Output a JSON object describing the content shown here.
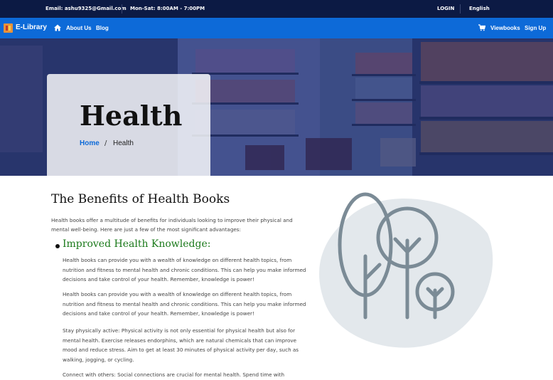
{
  "topbar": {
    "email": "Email: ashu9325@Gmail.com",
    "hours": "Mon-Sat: 8:00AM - 7:00PM",
    "login": "LOGIN",
    "language": "English"
  },
  "navbar": {
    "brand": "E-Library",
    "about": "About Us",
    "blog": "Blog",
    "viewbooks": "Viewbooks",
    "signup": "Sign Up"
  },
  "hero": {
    "title": "Health",
    "breadcrumb_home": "Home",
    "breadcrumb_sep": "/",
    "breadcrumb_current": "Health"
  },
  "content": {
    "title": "The Benefits of Health Books",
    "intro": "Health books offer a multitude of benefits for individuals looking to improve their physical and mental well-being. Here are just a few of the most significant advantages:",
    "subheading": "Improved Health Knowledge:",
    "p1": "Health books can provide you with a wealth of knowledge on different health topics, from nutrition and fitness to mental health and chronic conditions. This can help you make informed decisions and take control of your health. Remember, knowledge is power!",
    "p2": "Health books can provide you with a wealth of knowledge on different health topics, from nutrition and fitness to mental health and chronic conditions. This can help you make informed decisions and take control of your health. Remember, knowledge is power!",
    "p3": "Stay physically active: Physical activity is not only essential for physical health but also for mental health. Exercise releases endorphins, which are natural chemicals that can improve mood and reduce stress. Aim to get at least 30 minutes of physical activity per day, such as walking, jogging, or cycling.",
    "p4": "Connect with others: Social connections are crucial for mental health. Spend time with"
  },
  "colors": {
    "topbar": "#0c1a44",
    "navbar": "#0d6ad8",
    "link": "#0d6ad8",
    "subheading": "#1b7a1b",
    "illustration_blob": "#e3e8ec",
    "illustration_stroke": "#7b8b96"
  },
  "icons": [
    "home-icon",
    "cart-icon",
    "tree-illustration"
  ]
}
